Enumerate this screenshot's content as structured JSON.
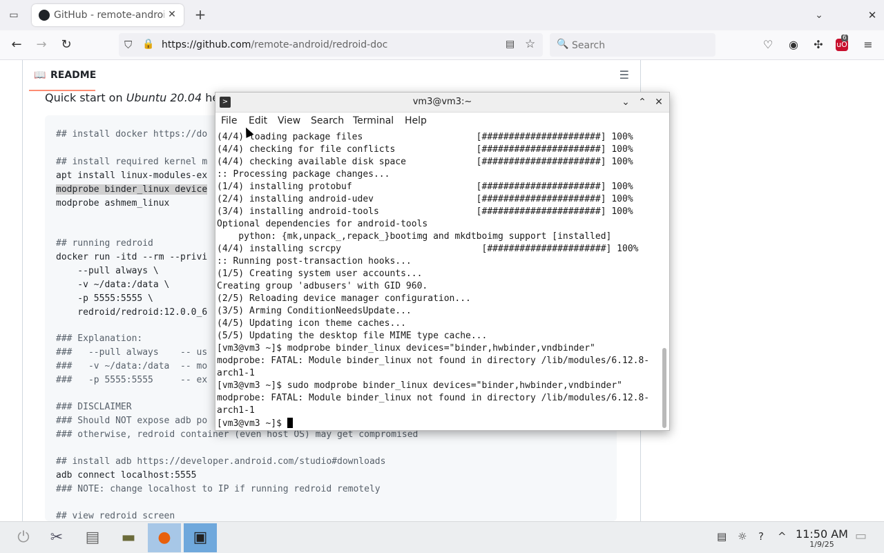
{
  "browser": {
    "tab_title": "GitHub - remote-android",
    "url_host": "https://github.com",
    "url_path": "/remote-android/redroid-doc",
    "search_placeholder": "Search",
    "ublock_badge": "6"
  },
  "readme": {
    "label": "README",
    "quickstart_prefix": "Quick start on ",
    "quickstart_os": "Ubuntu 20.04",
    "quickstart_suffix": " here"
  },
  "code_lines": [
    {
      "text": "## install docker https://do",
      "type": "comment"
    },
    {
      "text": "## install required kernel m",
      "type": "comment"
    },
    {
      "text": "apt install linux-modules-ex",
      "type": "code"
    },
    {
      "text": "modprobe binder_linux device",
      "type": "highlight"
    },
    {
      "text": "modprobe ashmem_linux",
      "type": "code"
    },
    {
      "text": "## running redroid",
      "type": "comment"
    },
    {
      "text": "docker run -itd --rm --privi",
      "type": "code"
    },
    {
      "text": "    --pull always \\",
      "type": "code"
    },
    {
      "text": "    -v ~/data:/data \\",
      "type": "code"
    },
    {
      "text": "    -p 5555:5555 \\",
      "type": "code"
    },
    {
      "text": "    redroid/redroid:12.0.0_6",
      "type": "code"
    },
    {
      "text": "### Explanation:",
      "type": "comment"
    },
    {
      "text": "###   --pull always    -- us",
      "type": "comment"
    },
    {
      "text": "###   -v ~/data:/data  -- mo",
      "type": "comment"
    },
    {
      "text": "###   -p 5555:5555     -- ex",
      "type": "comment"
    },
    {
      "text": "### DISCLAIMER",
      "type": "comment"
    },
    {
      "text": "### Should NOT expose adb po",
      "type": "comment"
    },
    {
      "text": "### otherwise, redroid container (even host OS) may get compromised",
      "type": "comment"
    },
    {
      "text": "## install adb https://developer.android.com/studio#downloads",
      "type": "comment"
    },
    {
      "text": "adb connect localhost:5555",
      "type": "code"
    },
    {
      "text": "### NOTE: change localhost to IP if running redroid remotely",
      "type": "comment"
    },
    {
      "text": "## view redroid screen",
      "type": "comment"
    }
  ],
  "terminal": {
    "title": "vm3@vm3:~",
    "menu": [
      "File",
      "Edit",
      "View",
      "Search",
      "Terminal",
      "Help"
    ],
    "lines": [
      "(4/4) loading package files                     [######################] 100%",
      "(4/4) checking for file conflicts               [######################] 100%",
      "(4/4) checking available disk space             [######################] 100%",
      ":: Processing package changes...",
      "(1/4) installing protobuf                       [######################] 100%",
      "(2/4) installing android-udev                   [######################] 100%",
      "(3/4) installing android-tools                  [######################] 100%",
      "Optional dependencies for android-tools",
      "    python: {mk,unpack_,repack_}bootimg and mkdtboimg support [installed]",
      "(4/4) installing scrcpy                          [######################] 100%",
      ":: Running post-transaction hooks...",
      "(1/5) Creating system user accounts...",
      "Creating group 'adbusers' with GID 960.",
      "(2/5) Reloading device manager configuration...",
      "(3/5) Arming ConditionNeedsUpdate...",
      "(4/5) Updating icon theme caches...",
      "(5/5) Updating the desktop file MIME type cache...",
      "[vm3@vm3 ~]$ modprobe binder_linux devices=\"binder,hwbinder,vndbinder\"",
      "modprobe: FATAL: Module binder_linux not found in directory /lib/modules/6.12.8-",
      "arch1-1",
      "[vm3@vm3 ~]$ sudo modprobe binder_linux devices=\"binder,hwbinder,vndbinder\"",
      "modprobe: FATAL: Module binder_linux not found in directory /lib/modules/6.12.8-",
      "arch1-1"
    ],
    "prompt": "[vm3@vm3 ~]$ "
  },
  "taskbar": {
    "time": "11:50 AM",
    "date": "1/9/25"
  },
  "colors": {
    "code_bg": "#f6f8fa",
    "readme_underline": "#fd8c73",
    "taskbar_active": "#6fa8dc"
  }
}
